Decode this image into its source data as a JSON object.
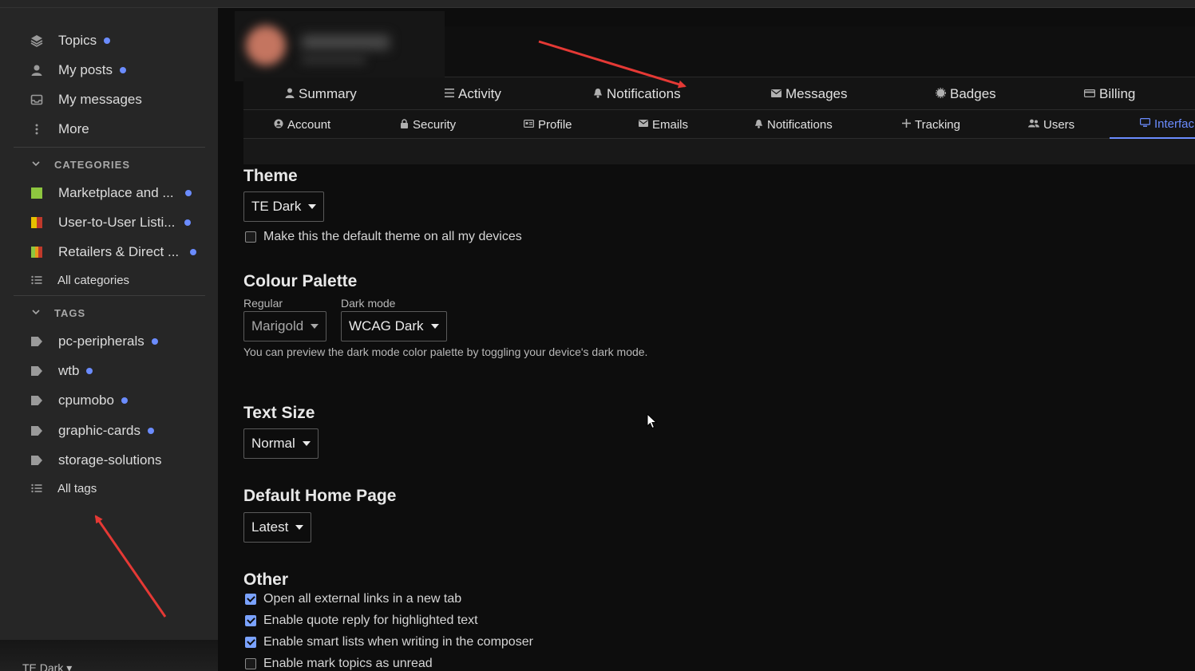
{
  "sidebar": {
    "items": [
      {
        "label": "Topics",
        "icon": "layers-icon",
        "dot": true
      },
      {
        "label": "My posts",
        "icon": "user-icon",
        "dot": true
      },
      {
        "label": "My messages",
        "icon": "inbox-icon",
        "dot": false
      },
      {
        "label": "More",
        "icon": "ellipsis-vertical-icon",
        "dot": false
      }
    ],
    "categories_heading": "CATEGORIES",
    "categories": [
      {
        "label": "Marketplace and ...",
        "colors": [
          "#8dc63f"
        ],
        "dot": true
      },
      {
        "label": "User-to-User Listi...",
        "colors": [
          "#e8c000",
          "#c0392b"
        ],
        "dot": true
      },
      {
        "label": "Retailers & Direct ...",
        "colors": [
          "#8dc63f",
          "#e89a1a"
        ],
        "dot": true
      }
    ],
    "all_categories": "All categories",
    "tags_heading": "TAGS",
    "tags": [
      {
        "label": "pc-peripherals",
        "dot": true
      },
      {
        "label": "wtb",
        "dot": true
      },
      {
        "label": "cpumobo",
        "dot": true
      },
      {
        "label": "graphic-cards",
        "dot": true
      },
      {
        "label": "storage-solutions",
        "dot": false
      }
    ],
    "all_tags": "All tags",
    "footer_theme": "TE Dark"
  },
  "nav": {
    "main": [
      "Summary",
      "Activity",
      "Notifications",
      "Messages",
      "Badges",
      "Billing"
    ],
    "sub": [
      "Account",
      "Security",
      "Profile",
      "Emails",
      "Notifications",
      "Tracking",
      "Users",
      "Interfac"
    ],
    "active_sub": "Interfac"
  },
  "content": {
    "theme_heading": "Theme",
    "theme_value": "TE Dark",
    "default_theme_label": "Make this the default theme on all my devices",
    "palette_heading": "Colour Palette",
    "regular_label": "Regular",
    "regular_value": "Marigold",
    "dark_label": "Dark mode",
    "dark_value": "WCAG Dark",
    "palette_help": "You can preview the dark mode color palette by toggling your device's dark mode.",
    "text_size_heading": "Text Size",
    "text_size_value": "Normal",
    "home_heading": "Default Home Page",
    "home_value": "Latest",
    "other_heading": "Other",
    "other_options": [
      {
        "label": "Open all external links in a new tab",
        "checked": true
      },
      {
        "label": "Enable quote reply for highlighted text",
        "checked": true
      },
      {
        "label": "Enable smart lists when writing in the composer",
        "checked": true
      },
      {
        "label": "Enable mark topics as unread",
        "checked": false
      }
    ]
  },
  "colors": {
    "accent": "#6b8cff",
    "annotation_arrow": "#e53935"
  }
}
